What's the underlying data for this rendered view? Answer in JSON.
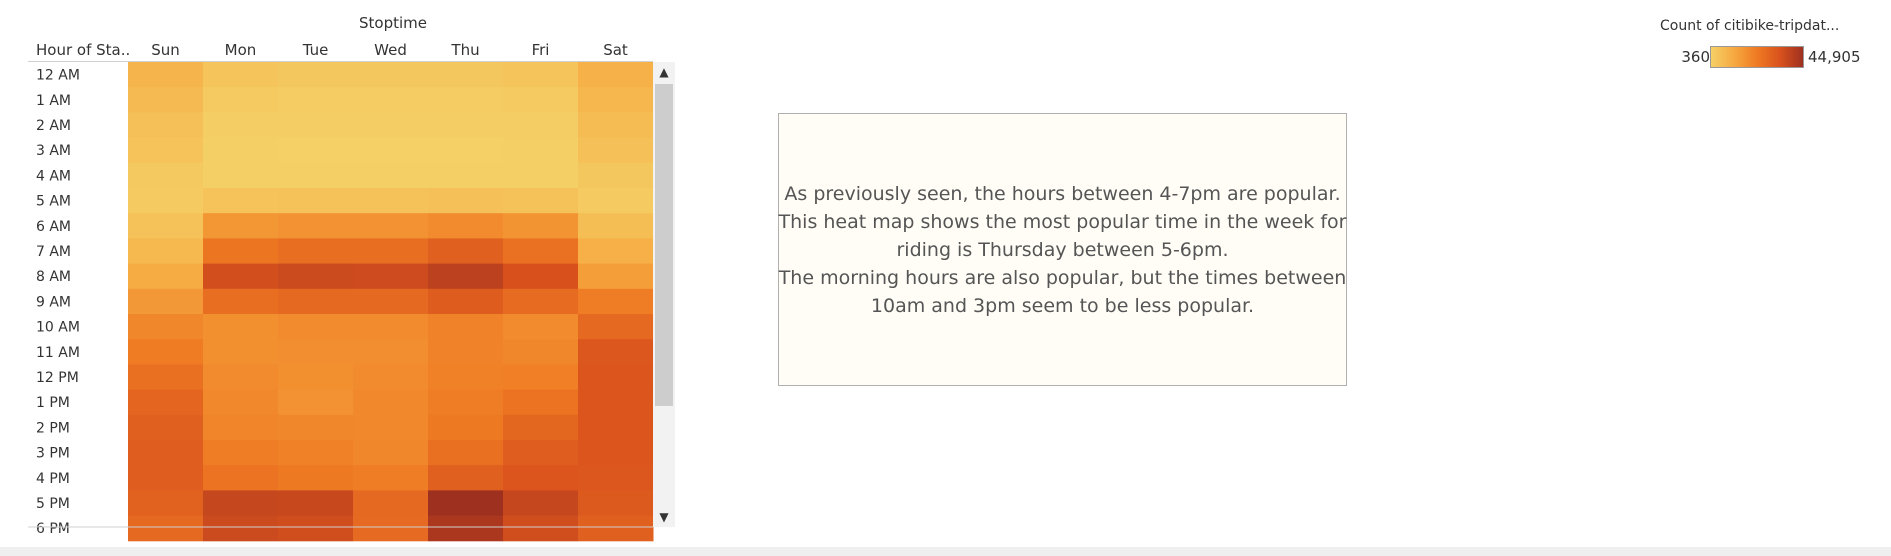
{
  "chart_data": {
    "type": "heatmap",
    "column_group_title": "Stoptime",
    "row_header": "Hour of Sta..",
    "x": [
      "Sun",
      "Mon",
      "Tue",
      "Wed",
      "Thu",
      "Fri",
      "Sat"
    ],
    "y": [
      "12 AM",
      "1 AM",
      "2 AM",
      "3 AM",
      "4 AM",
      "5 AM",
      "6 AM",
      "7 AM",
      "8 AM",
      "9 AM",
      "10 AM",
      "11 AM",
      "12 PM",
      "1 PM",
      "2 PM",
      "3 PM",
      "4 PM",
      "5 PM",
      "6 PM"
    ],
    "values": [
      [
        8000,
        3500,
        3000,
        3000,
        3000,
        3500,
        9000
      ],
      [
        6500,
        2000,
        1500,
        1500,
        1500,
        2000,
        7500
      ],
      [
        5000,
        1000,
        800,
        800,
        800,
        1200,
        6000
      ],
      [
        4000,
        700,
        500,
        500,
        500,
        700,
        5000
      ],
      [
        2500,
        700,
        600,
        600,
        600,
        700,
        3000
      ],
      [
        2000,
        4000,
        4500,
        4500,
        5000,
        4500,
        2200
      ],
      [
        4500,
        16000,
        17000,
        17000,
        18500,
        16500,
        5500
      ],
      [
        7000,
        24000,
        26000,
        26000,
        30000,
        25000,
        9500
      ],
      [
        10500,
        35000,
        36500,
        36000,
        39500,
        34000,
        14000
      ],
      [
        15500,
        26000,
        27500,
        27500,
        31000,
        26500,
        22000
      ],
      [
        19500,
        17500,
        18500,
        18500,
        20500,
        18500,
        27500
      ],
      [
        22500,
        17500,
        18000,
        18000,
        20500,
        19500,
        32500
      ],
      [
        25500,
        18500,
        17500,
        18500,
        21000,
        21500,
        33000
      ],
      [
        28500,
        19000,
        17000,
        19000,
        22000,
        24500,
        33000
      ],
      [
        30000,
        20000,
        19500,
        19000,
        23000,
        28000,
        33000
      ],
      [
        30500,
        22000,
        21000,
        19500,
        25500,
        30500,
        33000
      ],
      [
        30500,
        24500,
        23000,
        22000,
        30000,
        33000,
        32500
      ],
      [
        29500,
        37500,
        37000,
        27500,
        44905,
        37500,
        31500
      ],
      [
        27500,
        36500,
        35500,
        27000,
        42500,
        35500,
        30000
      ]
    ],
    "legend": {
      "title": "Count of citibike-tripdat...",
      "min_label": "360",
      "max_label": "44,905",
      "min": 360,
      "max": 44905,
      "colors": [
        "#f4d067",
        "#f6a940",
        "#ef7a23",
        "#d9521d",
        "#9e3020"
      ],
      "placement": "top-right"
    }
  },
  "annotation": {
    "lines": [
      "As previously seen, the hours between 4-7pm are popular.",
      "This heat map shows the most popular time in the week for",
      "riding is Thursday between 5-6pm.",
      "The morning hours are also popular, but the times between",
      "10am and 3pm seem to be less popular."
    ]
  },
  "scrollbar": {
    "up_icon": "▲",
    "down_icon": "▼",
    "icon_names": [
      "chevron-up-icon",
      "chevron-down-icon"
    ]
  }
}
